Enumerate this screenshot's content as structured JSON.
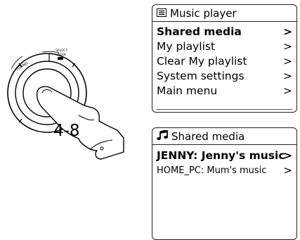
{
  "knob": {
    "label_tuning": "TUNING",
    "label_select_line1": "SELECT",
    "label_select_line2": "/SEEK",
    "step_label": "4-8"
  },
  "music_player": {
    "title": "Music player",
    "icon": "list-icon",
    "items": [
      {
        "label": "Shared media",
        "arrow": ">",
        "selected": true
      },
      {
        "label": "My playlist",
        "arrow": ">"
      },
      {
        "label": "Clear My playlist",
        "arrow": ">"
      },
      {
        "label": "System settings",
        "arrow": ">"
      },
      {
        "label": "Main menu",
        "arrow": ">"
      }
    ]
  },
  "shared_media": {
    "title": "Shared media",
    "icon": "music-note-icon",
    "items": [
      {
        "label": "JENNY: Jenny's music",
        "arrow": ">",
        "selected": true
      },
      {
        "label": "HOME_PC: Mum's music",
        "arrow": ">"
      }
    ]
  }
}
